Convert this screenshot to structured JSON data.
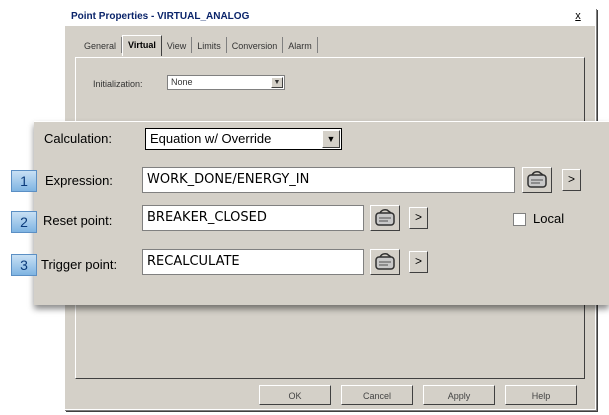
{
  "dialog": {
    "title": "Point Properties - VIRTUAL_ANALOG",
    "close": "x",
    "tabs": [
      "General",
      "Virtual",
      "View",
      "Limits",
      "Conversion",
      "Alarm"
    ],
    "active_tab": "Virtual",
    "initialization_label": "Initialization:",
    "initialization_value": "None",
    "buttons": {
      "ok": "OK",
      "cancel": "Cancel",
      "apply": "Apply",
      "help": "Help"
    }
  },
  "panel": {
    "calculation_label": "Calculation:",
    "calculation_value": "Equation w/ Override",
    "expression": {
      "badge": "1",
      "label": "Expression:",
      "value": "WORK_DONE/ENERGY_IN"
    },
    "reset": {
      "badge": "2",
      "label": "Reset point:",
      "value": "BREAKER_CLOSED"
    },
    "trigger": {
      "badge": "3",
      "label": "Trigger point:",
      "value": "RECALCULATE"
    },
    "local_label": "Local",
    "local_checked": false,
    "arrow_glyph": ">"
  },
  "colors": {
    "face": "#d4d0c8",
    "badge": "#7fb4e2",
    "title_text": "#0a246a"
  }
}
